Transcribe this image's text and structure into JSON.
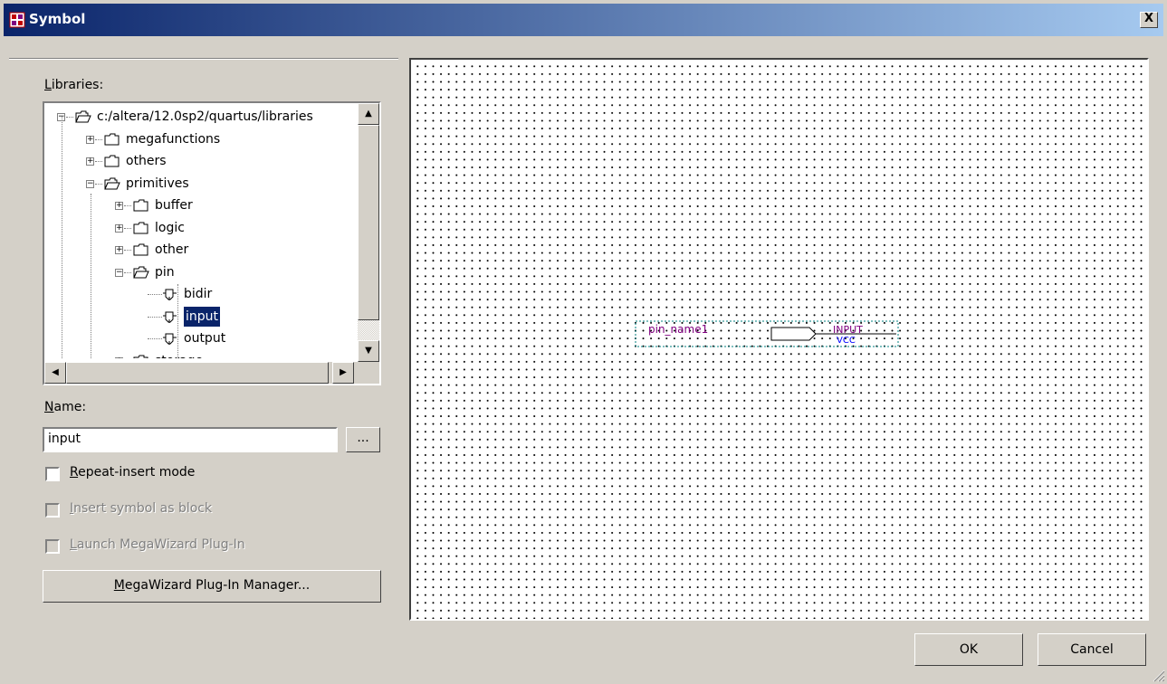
{
  "window": {
    "title": "Symbol",
    "close_label": "X",
    "title_icon": "symbol-app-icon"
  },
  "libraries": {
    "label_prefix": "",
    "label_accel": "L",
    "label_rest": "ibraries:",
    "tree": [
      {
        "label": "c:/altera/12.0sp2/quartus/libraries",
        "icon": "folder-open-icon",
        "expander": "−"
      },
      {
        "label": "megafunctions",
        "icon": "folder-icon",
        "expander": "+"
      },
      {
        "label": "others",
        "icon": "folder-icon",
        "expander": "+"
      },
      {
        "label": "primitives",
        "icon": "folder-open-icon",
        "expander": "−"
      },
      {
        "label": "buffer",
        "icon": "folder-icon",
        "expander": "+"
      },
      {
        "label": "logic",
        "icon": "folder-icon",
        "expander": "+"
      },
      {
        "label": "other",
        "icon": "folder-icon",
        "expander": "+"
      },
      {
        "label": "pin",
        "icon": "folder-open-icon",
        "expander": "−"
      },
      {
        "label": "bidir",
        "icon": "pin-symbol-icon",
        "expander": ""
      },
      {
        "label": "input",
        "icon": "pin-symbol-icon",
        "expander": "",
        "selected": true
      },
      {
        "label": "output",
        "icon": "pin-symbol-icon",
        "expander": ""
      },
      {
        "label": "storage",
        "icon": "folder-icon",
        "expander": "+"
      }
    ]
  },
  "name": {
    "label_accel": "N",
    "label_rest": "ame:",
    "value": "input",
    "browse_label": "..."
  },
  "options": {
    "repeat_insert": {
      "accel": "R",
      "rest": "epeat-insert mode",
      "checked": false,
      "enabled": true
    },
    "insert_block": {
      "accel": "I",
      "rest": "nsert symbol as block",
      "checked": false,
      "enabled": false
    },
    "launch_wizard": {
      "accel": "L",
      "rest": "aunch MegaWizard Plug-In",
      "checked": false,
      "enabled": false
    }
  },
  "megawizard_button": {
    "accel": "M",
    "rest": "egaWizard Plug-In Manager..."
  },
  "preview": {
    "pin_name": "pin_name1",
    "type_label": "INPUT",
    "default_value": "VCC",
    "dot_color": "#000000",
    "pin_text_color": "#800080",
    "vcc_color": "#0000ff"
  },
  "buttons": {
    "ok": "OK",
    "cancel": "Cancel"
  }
}
